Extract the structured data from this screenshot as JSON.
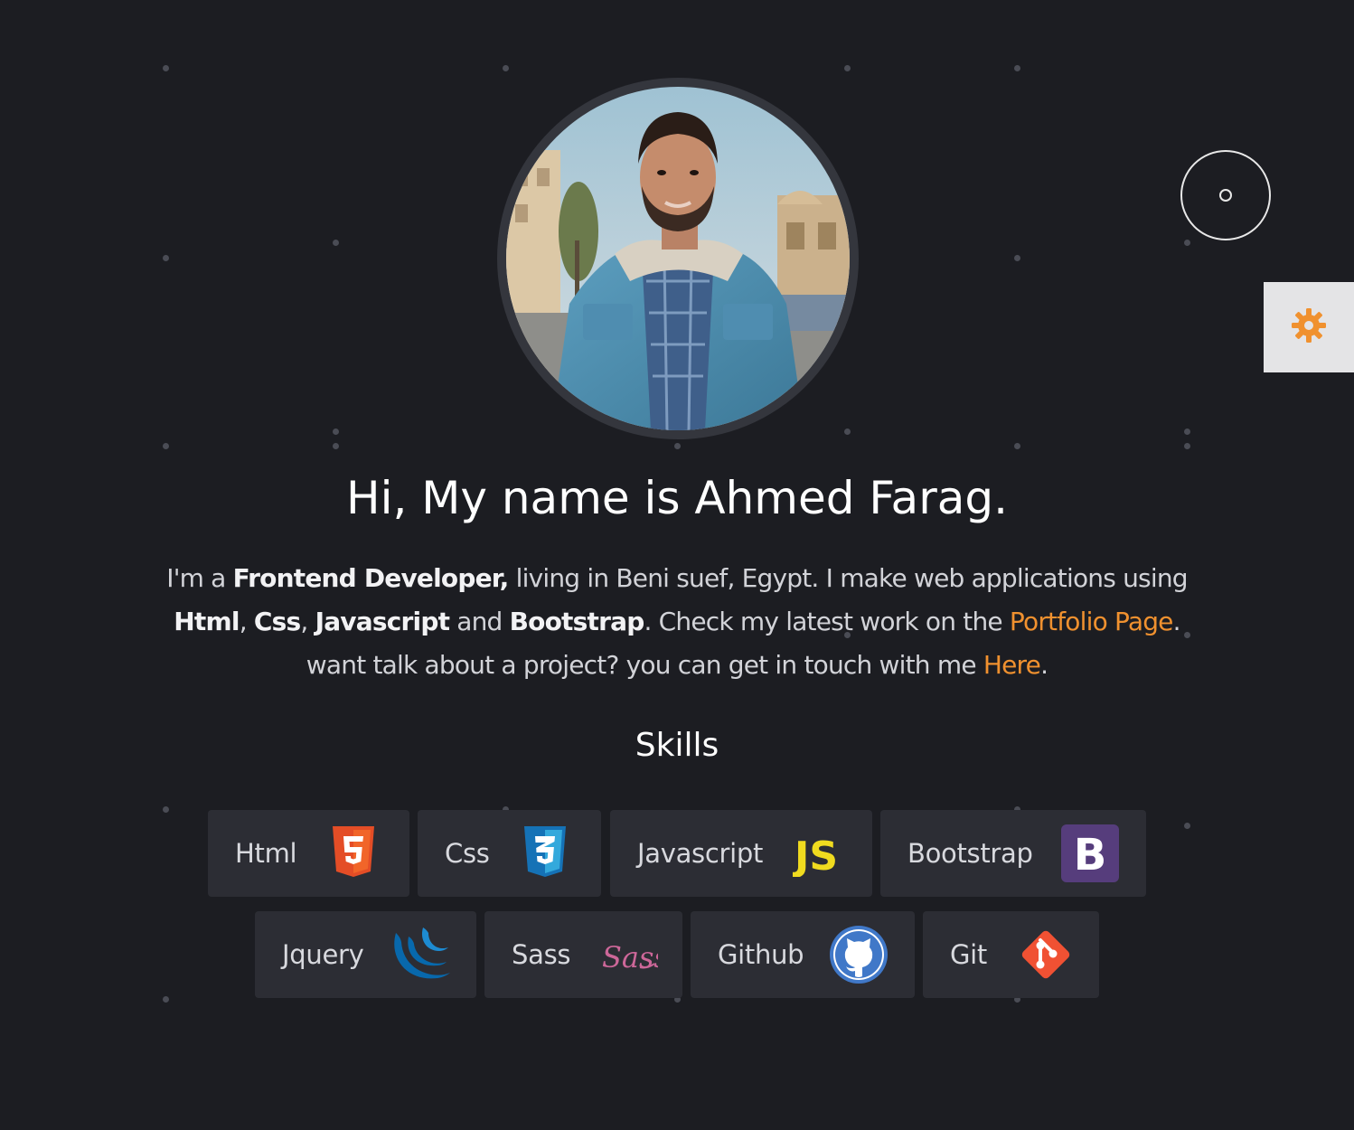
{
  "profile": {
    "greeting": "Hi, My name is Ahmed Farag."
  },
  "bio": {
    "p1_before": "I'm a ",
    "p1_role": "Frontend Developer,",
    "p1_after": " living in Beni suef, Egypt. I make web applications using",
    "skill_html": "Html",
    "sep1": ", ",
    "skill_css": "Css",
    "sep2": ", ",
    "skill_js": "Javascript",
    "and": " and ",
    "skill_bootstrap": "Bootstrap",
    "check": ". Check my latest work on the ",
    "portfolio_link": "Portfolio Page",
    "dot1": ".",
    "contact": "want talk about a project? you can get in touch with me ",
    "here_link": "Here",
    "dot2": "."
  },
  "skills_section": {
    "title": "Skills",
    "items": [
      {
        "label": "Html",
        "icon": "html5-icon"
      },
      {
        "label": "Css",
        "icon": "css3-icon"
      },
      {
        "label": "Javascript",
        "icon": "js-icon"
      },
      {
        "label": "Bootstrap",
        "icon": "bootstrap-icon"
      },
      {
        "label": "Jquery",
        "icon": "jquery-icon"
      },
      {
        "label": "Sass",
        "icon": "sass-icon"
      },
      {
        "label": "Github",
        "icon": "github-icon"
      },
      {
        "label": "Git",
        "icon": "git-icon"
      }
    ]
  },
  "logo_text": {
    "js": "JS",
    "bootstrap": "B",
    "sass": "Sass"
  },
  "settings": {
    "icon": "gear-icon"
  },
  "colors": {
    "background": "#1c1d22",
    "accent": "#f0912f",
    "card": "#2c2d34",
    "settings_tab": "#e4e4e6"
  }
}
